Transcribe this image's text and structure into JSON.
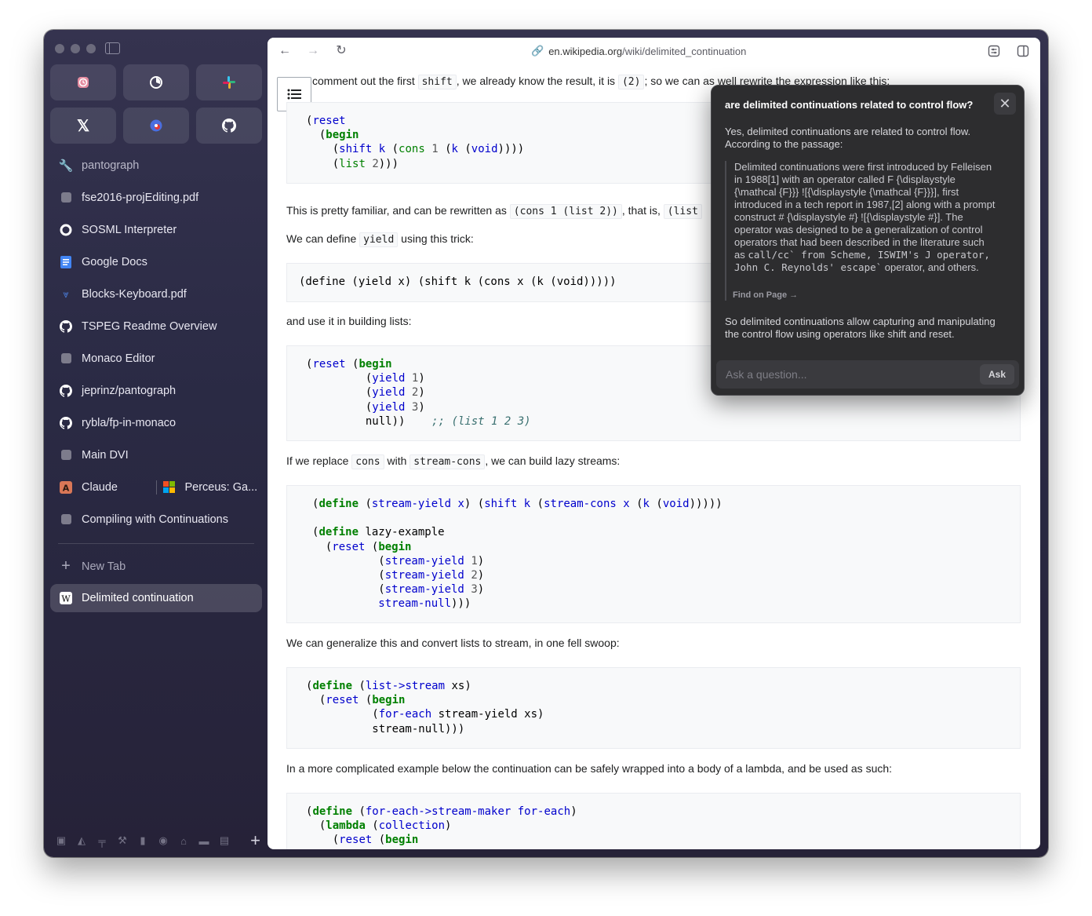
{
  "browser": {
    "url_host": "en.wikipedia.org",
    "url_path": "/wiki/delimited_continuation"
  },
  "sidebar": {
    "pinned": [
      "clock-app-icon",
      "timer-app-icon",
      "slack-icon",
      "x-icon",
      "chrome-app-icon",
      "github-icon"
    ],
    "tabs": [
      {
        "label": "pantograph",
        "icon": "wrench-icon"
      },
      {
        "label": "fse2016-projEditing.pdf",
        "icon": "square-icon"
      },
      {
        "label": "SOSML Interpreter",
        "icon": "ring-icon"
      },
      {
        "label": "Google Docs",
        "icon": "docs-icon"
      },
      {
        "label": "Blocks-Keyboard.pdf",
        "icon": "feather-icon"
      },
      {
        "label": "TSPEG Readme Overview",
        "icon": "github-icon"
      },
      {
        "label": "Monaco Editor",
        "icon": "square-icon"
      },
      {
        "label": "jeprinz/pantograph",
        "icon": "github-icon"
      },
      {
        "label": "rybla/fp-in-monaco",
        "icon": "github-icon"
      },
      {
        "label": "Main DVI",
        "icon": "square-icon"
      }
    ],
    "split_left": "Claude",
    "split_right": "Perceus: Ga...",
    "tab_after_split": "Compiling with Continuations",
    "new_tab": "New Tab",
    "active_tab": "Delimited continuation"
  },
  "article": {
    "p1_a": "comment out the first ",
    "p1_code1": "shift",
    "p1_b": ", we already know the result, it is ",
    "p1_code2": "(2)",
    "p1_c": "; so we can as well rewrite the expression like this:",
    "p2_a": "This is pretty familiar, and can be rewritten as ",
    "p2_code1": "(cons 1 (list 2))",
    "p2_b": ", that is, ",
    "p2_code2": "(list",
    "p3_a": "We can define ",
    "p3_code": "yield",
    "p3_b": " using this trick:",
    "p4": "and use it in building lists:",
    "p5_a": "If we replace ",
    "p5_code1": "cons",
    "p5_b": " with ",
    "p5_code2": "stream-cons",
    "p5_c": ", we can build lazy streams:",
    "p6": "We can generalize this and convert lists to stream, in one fell swoop:",
    "p7": "In a more complicated example below the continuation can be safely wrapped into a body of a lambda, and be used as such:"
  },
  "ai_popup": {
    "question": "are delimited continuations related to control flow?",
    "answer_intro_1": "Yes, delimited continuations are related to control flow.",
    "answer_intro_2": "According to the passage:",
    "quote_lines": [
      "Delimited continuations were first introduced by Felleisen",
      "in 1988[1] with an operator called F {\\displaystyle",
      "{\\mathcal {F}}} ![{\\displaystyle {\\mathcal {F}}}], first",
      "introduced in a tech report in 1987,[2] along with a prompt",
      "construct # {\\displaystyle #} ![{\\displaystyle #}]. The",
      "operator was designed to be a generalization of control",
      "operators that had been described in the literature such"
    ],
    "quote_mono_1_a": "as ",
    "quote_mono_1_b": "call/cc` from Scheme, ISWIM's J operator,",
    "quote_mono_2_a": "John C. Reynolds' escape`",
    "quote_mono_2_b": " operator, and others.",
    "find_on_page": "Find on Page →",
    "answer_outro_1": "So delimited continuations allow capturing and manipulating",
    "answer_outro_2": "the control flow using operators like shift and reset.",
    "input_placeholder": "Ask a question...",
    "ask_label": "Ask"
  }
}
